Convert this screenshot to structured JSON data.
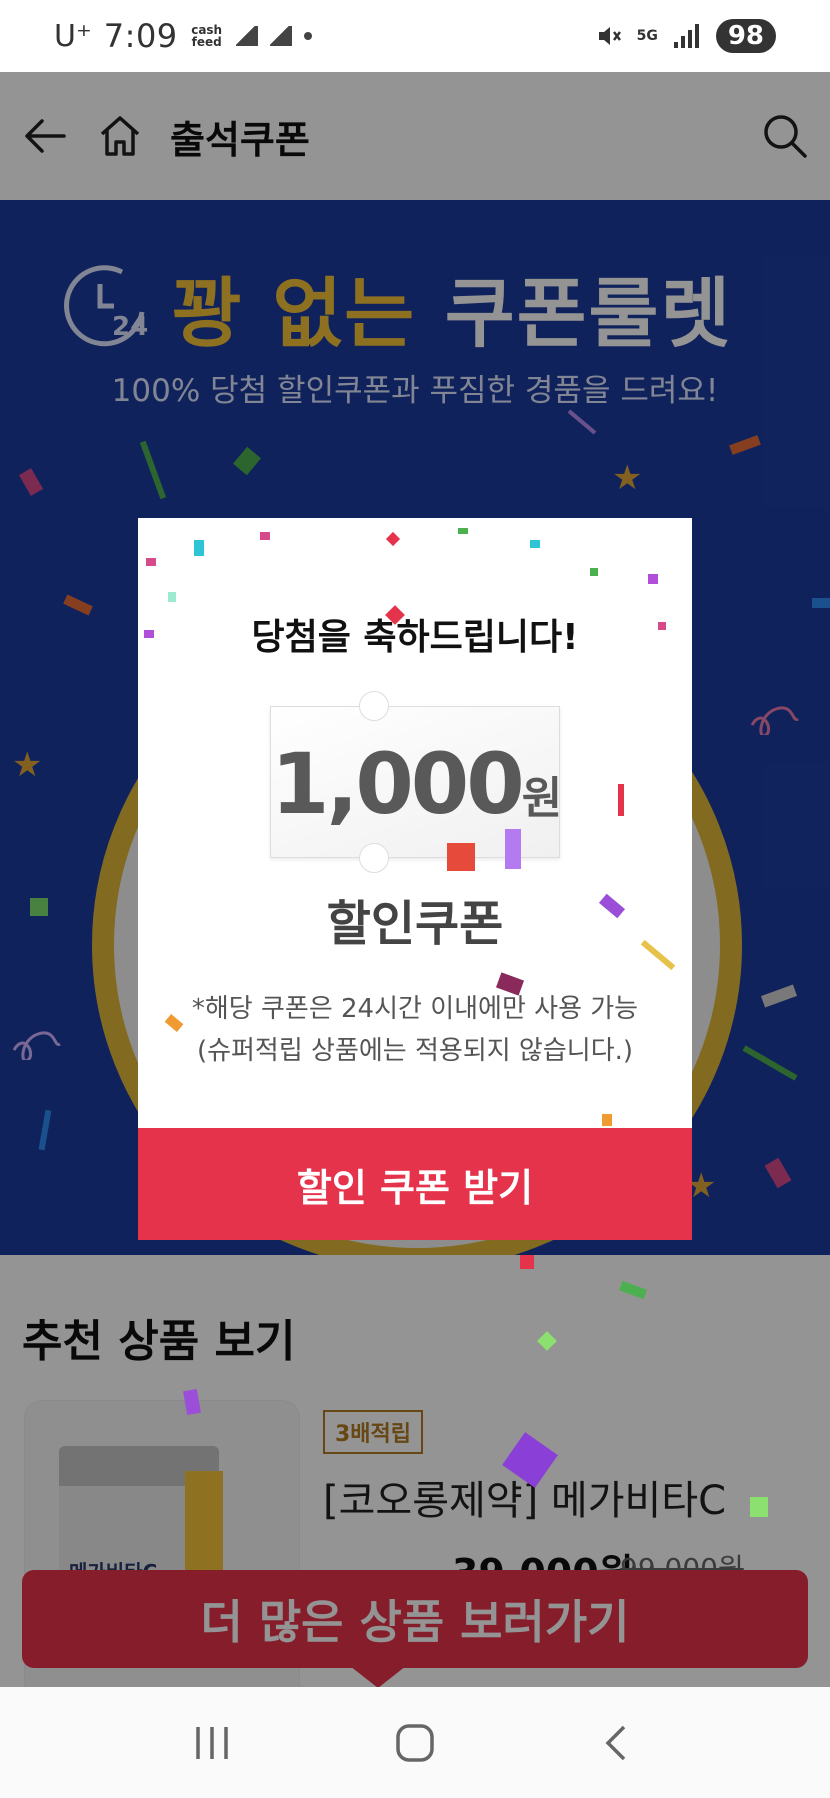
{
  "status_bar": {
    "carrier": "U⁺",
    "time": "7:09",
    "cash_app": "cash feed",
    "network": "5G",
    "battery": "98"
  },
  "header": {
    "title": "출석쿠폰",
    "icons": [
      "back-arrow-icon",
      "home-icon",
      "search-icon"
    ]
  },
  "banner": {
    "clock_label": "24",
    "headline_part1": "꽝 없는",
    "headline_part2": "쿠폰룰렛",
    "subline": "100% 당첨 할인쿠폰과 푸짐한 경품을 드려요!",
    "colors": {
      "background": "#1d3c9e",
      "gold": "#f4c23a"
    }
  },
  "modal": {
    "congrats": "당첨을 축하드립니다!",
    "coupon_amount": "1,000",
    "coupon_unit": "원",
    "coupon_type": "할인쿠폰",
    "note_line1": "*해당 쿠폰은 24시간 이내에만 사용 가능",
    "note_line2": "(슈퍼적립 상품에는 적용되지 않습니다.)",
    "button_label": "할인 쿠폰 받기",
    "accent": "#e5334b"
  },
  "recommend": {
    "section_title": "추천 상품 보기",
    "product": {
      "badge": "3배적립",
      "name": "[코오롱제약] 메가비타C",
      "package_text": "메가비타C",
      "price": "39,000원",
      "original_price": "99,000원"
    }
  },
  "more_button": "더 많은 상품 보러가기",
  "nav_bar": [
    "recent-apps-icon",
    "home-circle-icon",
    "nav-back-icon"
  ]
}
